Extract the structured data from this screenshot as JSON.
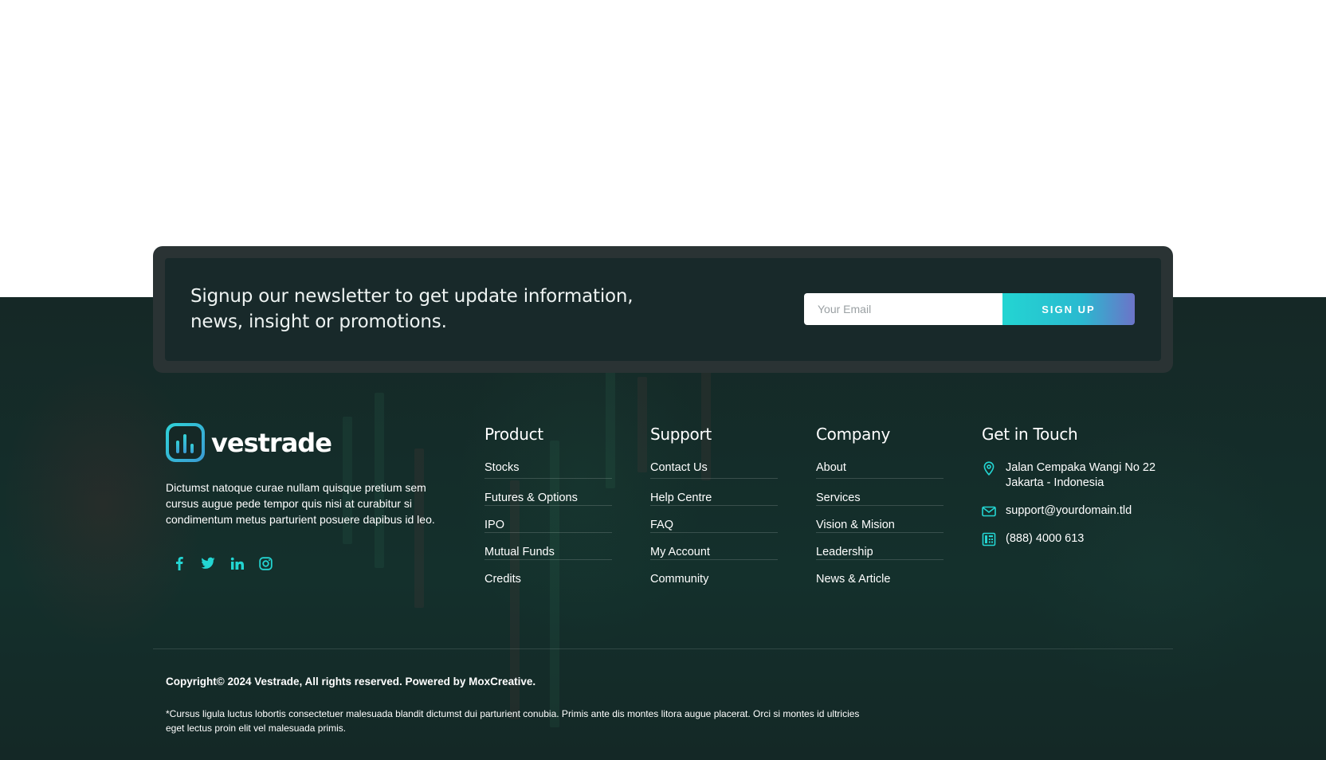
{
  "newsletter": {
    "title": "Signup our newsletter to get update information, news, insight or promotions.",
    "email_placeholder": "Your Email",
    "button_label": "SIGN UP"
  },
  "brand": {
    "name": "vestrade",
    "description": "Dictumst natoque curae nullam quisque pretium sem cursus augue pede tempor quis nisi at curabitur si condimentum metus parturient posuere dapibus id leo.",
    "socials": [
      "facebook-icon",
      "twitter-icon",
      "linkedin-icon",
      "instagram-icon"
    ]
  },
  "columns": [
    {
      "title": "Product",
      "items": [
        "Stocks",
        "Futures & Options",
        "IPO",
        "Mutual Funds",
        "Credits"
      ]
    },
    {
      "title": "Support",
      "items": [
        "Contact Us",
        "Help Centre",
        "FAQ",
        "My Account",
        "Community"
      ]
    },
    {
      "title": "Company",
      "items": [
        "About",
        "Services",
        "Vision & Mision",
        "Leadership",
        "News & Article"
      ]
    }
  ],
  "contact": {
    "title": "Get in Touch",
    "address_line1": "Jalan Cempaka Wangi No 22",
    "address_line2": "Jakarta - Indonesia",
    "email": "support@yourdomain.tld",
    "phone": "(888) 4000 613"
  },
  "footer": {
    "copyright": "Copyright© 2024 Vestrade, All rights reserved. Powered by MoxCreative.",
    "disclaimer": "*Cursus ligula luctus lobortis consectetuer malesuada blandit dictumst dui parturient conubia. Primis ante dis montes litora augue placerat. Orci si montes id ultricies eget lectus proin elit vel malesuada primis."
  },
  "colors": {
    "footer_bg": "#152826",
    "accent": "#23d5d2",
    "accent_end": "#6c73c8"
  }
}
